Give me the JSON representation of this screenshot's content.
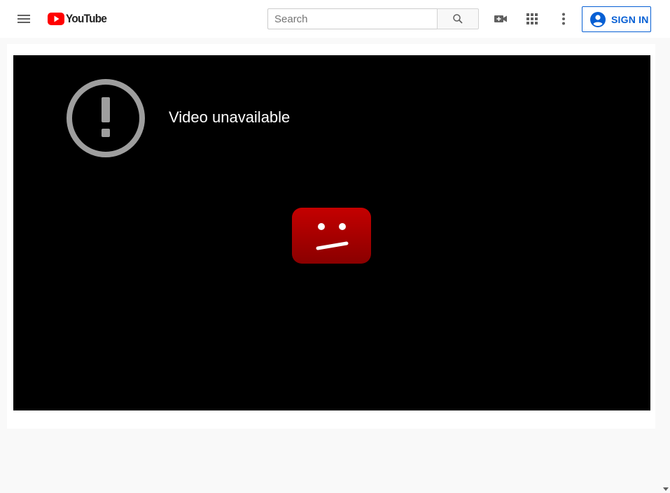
{
  "header": {
    "logo_text": "YouTube",
    "search_placeholder": "Search",
    "signin_label": "SIGN IN"
  },
  "player": {
    "error_message": "Video unavailable"
  },
  "icons": {
    "menu": "hamburger-menu-icon",
    "logo": "youtube-play-icon",
    "search": "search-icon",
    "create": "video-camera-plus-icon",
    "apps": "apps-grid-icon",
    "more": "more-vert-icon",
    "account": "account-circle-icon",
    "error": "exclamation-circle-icon",
    "sad": "sad-youtube-icon"
  },
  "colors": {
    "brand_red": "#ff0000",
    "link_blue": "#065fd4",
    "player_bg": "#000000",
    "error_gray": "#9e9e9e",
    "sad_red": "#b30000"
  }
}
